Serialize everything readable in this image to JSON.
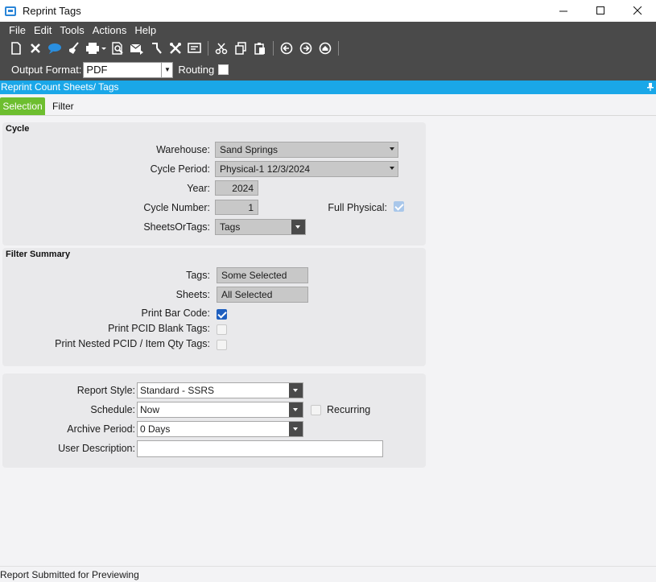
{
  "window": {
    "title": "Reprint Tags"
  },
  "menu": [
    "File",
    "Edit",
    "Tools",
    "Actions",
    "Help"
  ],
  "toolbar": {
    "icons": [
      "new-icon",
      "delete-icon",
      "chat-icon",
      "clear-icon",
      "print-icon",
      "print-preview-icon",
      "email-icon",
      "attach-icon",
      "tools-icon",
      "screen-icon",
      "cut-icon",
      "copy-icon",
      "paste-icon",
      "back-icon",
      "forward-icon",
      "home-icon"
    ]
  },
  "output": {
    "label": "Output Format:",
    "value": "PDF",
    "routing_label": "Routing"
  },
  "panel": {
    "title": "Reprint Count Sheets/ Tags"
  },
  "tabs": {
    "selection": "Selection",
    "filter": "Filter"
  },
  "cycle": {
    "title": "Cycle",
    "warehouse_label": "Warehouse:",
    "warehouse_value": "Sand Springs",
    "period_label": "Cycle Period:",
    "period_value": "Physical-1 12/3/2024",
    "year_label": "Year:",
    "year_value": "2024",
    "number_label": "Cycle Number:",
    "number_value": "1",
    "full_physical_label": "Full Physical:",
    "sheets_label": "SheetsOrTags:",
    "sheets_value": "Tags"
  },
  "filter_summary": {
    "title": "Filter Summary",
    "tags_label": "Tags:",
    "tags_value": "Some Selected",
    "sheets_label": "Sheets:",
    "sheets_value": "All Selected",
    "barcode_label": "Print Bar Code:",
    "pcid_blank_label": "Print PCID Blank Tags:",
    "nested_label": "Print Nested PCID / Item Qty Tags:"
  },
  "report": {
    "style_label": "Report Style:",
    "style_value": "Standard - SSRS",
    "schedule_label": "Schedule:",
    "schedule_value": "Now",
    "recurring_label": "Recurring",
    "archive_label": "Archive Period:",
    "archive_value": "0 Days",
    "desc_label": "User Description:",
    "desc_value": ""
  },
  "status": {
    "text": "Report Submitted for Previewing"
  },
  "colors": {
    "accent": "#1aa7e8",
    "tab_active": "#6dbe2f",
    "chrome": "#4a4a4a"
  }
}
